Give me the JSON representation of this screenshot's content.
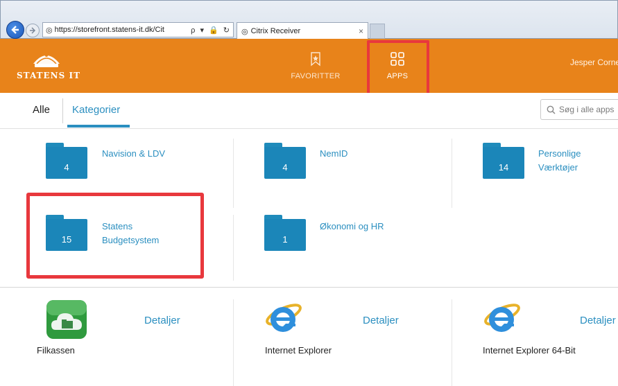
{
  "browser": {
    "address": "https://storefront.statens-it.dk/Cit",
    "address_tools": "ρ ▾ 🔒 ↻",
    "tab_title": "Citrix Receiver",
    "tab_close": "×"
  },
  "header": {
    "logo_text": "STATENS IT",
    "nav": [
      {
        "label": "FAVORITTER",
        "icon": "bookmark-icon"
      },
      {
        "label": "APPS",
        "icon": "apps-grid-icon"
      }
    ],
    "user": "Jesper Corne"
  },
  "subnav": {
    "all_label": "Alle",
    "categories_label": "Kategorier",
    "search_placeholder": "Søg i alle apps"
  },
  "categories": [
    {
      "name": "Navision & LDV",
      "count": "4"
    },
    {
      "name": "NemID",
      "count": "4"
    },
    {
      "name": "Personlige Værktøjer",
      "count": "14"
    },
    {
      "name": "Statens Budgetsystem",
      "count": "15"
    },
    {
      "name": "Økonomi og HR",
      "count": "1"
    }
  ],
  "apps": [
    {
      "name": "Filkassen",
      "detail": "Detaljer",
      "icon": "filkassen-cloud-icon"
    },
    {
      "name": "Internet Explorer",
      "detail": "Detaljer",
      "icon": "internet-explorer-icon"
    },
    {
      "name": "Internet Explorer 64-Bit",
      "detail": "Detaljer",
      "icon": "internet-explorer-icon"
    }
  ],
  "colors": {
    "header_orange": "#e8831a",
    "accent_blue": "#2b8fc0",
    "folder_blue": "#1b86b9",
    "highlight_red": "#e8383d"
  }
}
